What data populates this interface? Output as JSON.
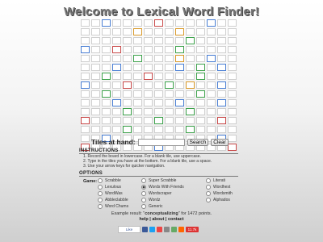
{
  "title": "Welcome to Lexical Word Finder!",
  "board": {
    "size": 15,
    "cells": [
      "..b....r....b..",
      ".....o...o.....",
      "..........g....",
      "b..r.....g.....",
      ".....g...o..b..",
      "...b.....b.g.b.",
      "..g...r....g...",
      "b...r...g.o..b.",
      "..g........g...",
      "...b.....b...b.",
      "....g.....g....",
      "r......g.....r.",
      "....g.....g....",
      "..b..........b.",
      "r......b......r"
    ]
  },
  "tiles": {
    "label": "Tiles at hand:",
    "placeholder": "",
    "search_label": "Search",
    "clear_label": "Clear"
  },
  "instructions": {
    "heading": "INSTRUCTIONS",
    "items": [
      "1.   Record the board in lowercase. For a blank tile, use uppercase.",
      "2.   Type in the tiles you have at the bottom. For a blank tile, use a space.",
      "3.   Use your arrow keys for quicker navigation."
    ]
  },
  "options": {
    "heading": "OPTIONS",
    "game_label": "Game:",
    "games": [
      [
        "Scrabble",
        "Super Scrabble",
        "Literati"
      ],
      [
        "Lexulous",
        "Words With Friends",
        "Wordhest"
      ],
      [
        "WordWas",
        "Wordscraper",
        "Wordsmith"
      ],
      [
        "Abbleclabble",
        "Wordz",
        "Alphados"
      ],
      [
        "Word Chums",
        "Generic",
        ""
      ]
    ],
    "selected": "Words With Friends"
  },
  "example": {
    "prefix": "Example result: \"",
    "word": "conceptualizing",
    "suffix": "\" for 1472 points."
  },
  "footer": {
    "help": "help",
    "about": "about",
    "contact": "contact",
    "sep": " | "
  },
  "social": {
    "like_label": "Like",
    "count_label": "11.7k"
  },
  "colors": {
    "b": "#4a7fd4",
    "g": "#3fa34d",
    "r": "#c94a4a",
    "o": "#d99a2b"
  }
}
